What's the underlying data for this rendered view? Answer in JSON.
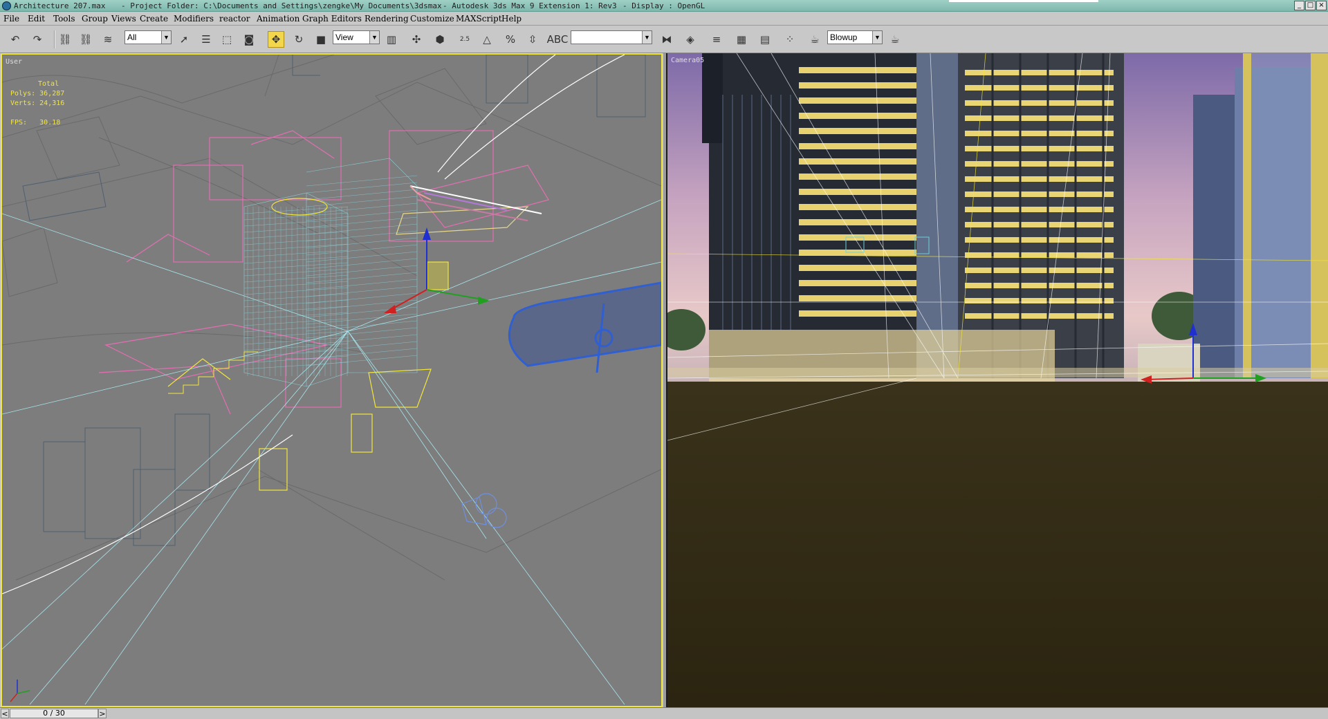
{
  "window": {
    "filename": "Architecture 207.max",
    "project_folder": "- Project Folder: C:\\Documents and Settings\\zengke\\My Documents\\3dsmax",
    "app": "- Autodesk 3ds Max 9 Extension 1: Rev3",
    "display": "- Display : OpenGL",
    "controls": [
      "_",
      "□",
      "×"
    ]
  },
  "menu": [
    "File",
    "Edit",
    "Tools",
    "Group",
    "Views",
    "Create",
    "Modifiers",
    "reactor",
    "Animation",
    "Graph Editors",
    "Rendering",
    "Customize",
    "MAXScript",
    "Help"
  ],
  "toolbar": {
    "selection_filter": "All",
    "reference_coord": "View",
    "named_selection": "",
    "render_preset": "Blowup",
    "snap_label": "2.5"
  },
  "viewports": {
    "left": {
      "label": "User",
      "stats_total": "Total",
      "stats_polys": "Polys: 36,287",
      "stats_verts": "Verts: 24,316",
      "stats_fps": "FPS:   30.18"
    },
    "right": {
      "label": "Camera05"
    }
  },
  "timeline": {
    "frame": "0 / 30",
    "prev": "<",
    "next": ">"
  },
  "colors": {
    "active_border": "#f3e63a",
    "wireframe_pink": "#e36fb1",
    "wireframe_cyan": "#8fd8e0",
    "viewport_grey": "#7d7d7d",
    "ground_dark": "#2d2712"
  }
}
